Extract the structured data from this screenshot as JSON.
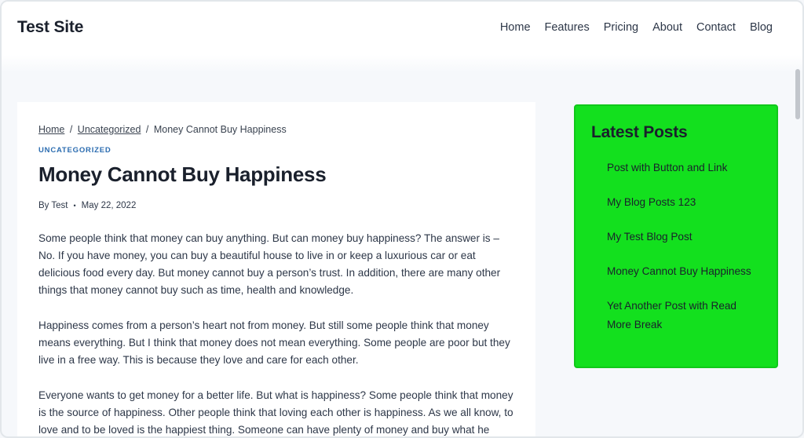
{
  "header": {
    "site_title": "Test Site",
    "nav": [
      "Home",
      "Features",
      "Pricing",
      "About",
      "Contact",
      "Blog"
    ]
  },
  "breadcrumb": {
    "home": "Home",
    "separator": "/",
    "category": "Uncategorized",
    "current": "Money Cannot Buy Happiness"
  },
  "post": {
    "category": "UNCATEGORIZED",
    "title": "Money Cannot Buy Happiness",
    "author": "By Test",
    "meta_separator": "•",
    "date": "May 22, 2022",
    "paragraphs": [
      "Some people think that money can buy anything. But can money buy happiness? The answer is – No. If you have money, you can buy a beautiful house to live in or keep a luxurious car or eat delicious food every day. But money cannot buy a person’s trust. In addition, there are many other things that money cannot buy such as time, health and knowledge.",
      "Happiness comes from a person’s heart not from money. But still some people think that money means everything. But I think that money does not mean everything. Some people are poor but they live in a free way. This is because they love and care for each other.",
      "Everyone wants to get money for a better life. But what is happiness? Some people think that money is the source of happiness. Other people think that loving each other is happiness. As we all know, to love and to be loved is the happiest thing. Someone can have plenty of money and buy what he"
    ]
  },
  "sidebar": {
    "title": "Latest Posts",
    "posts": [
      "Post with Button and Link",
      "My Blog Posts 123",
      "My Test Blog Post",
      "Money Cannot Buy Happiness",
      "Yet Another Post with Read More Break"
    ]
  },
  "colors": {
    "sidebar_bg": "#13e01e",
    "category_link": "#2b6cb0"
  }
}
